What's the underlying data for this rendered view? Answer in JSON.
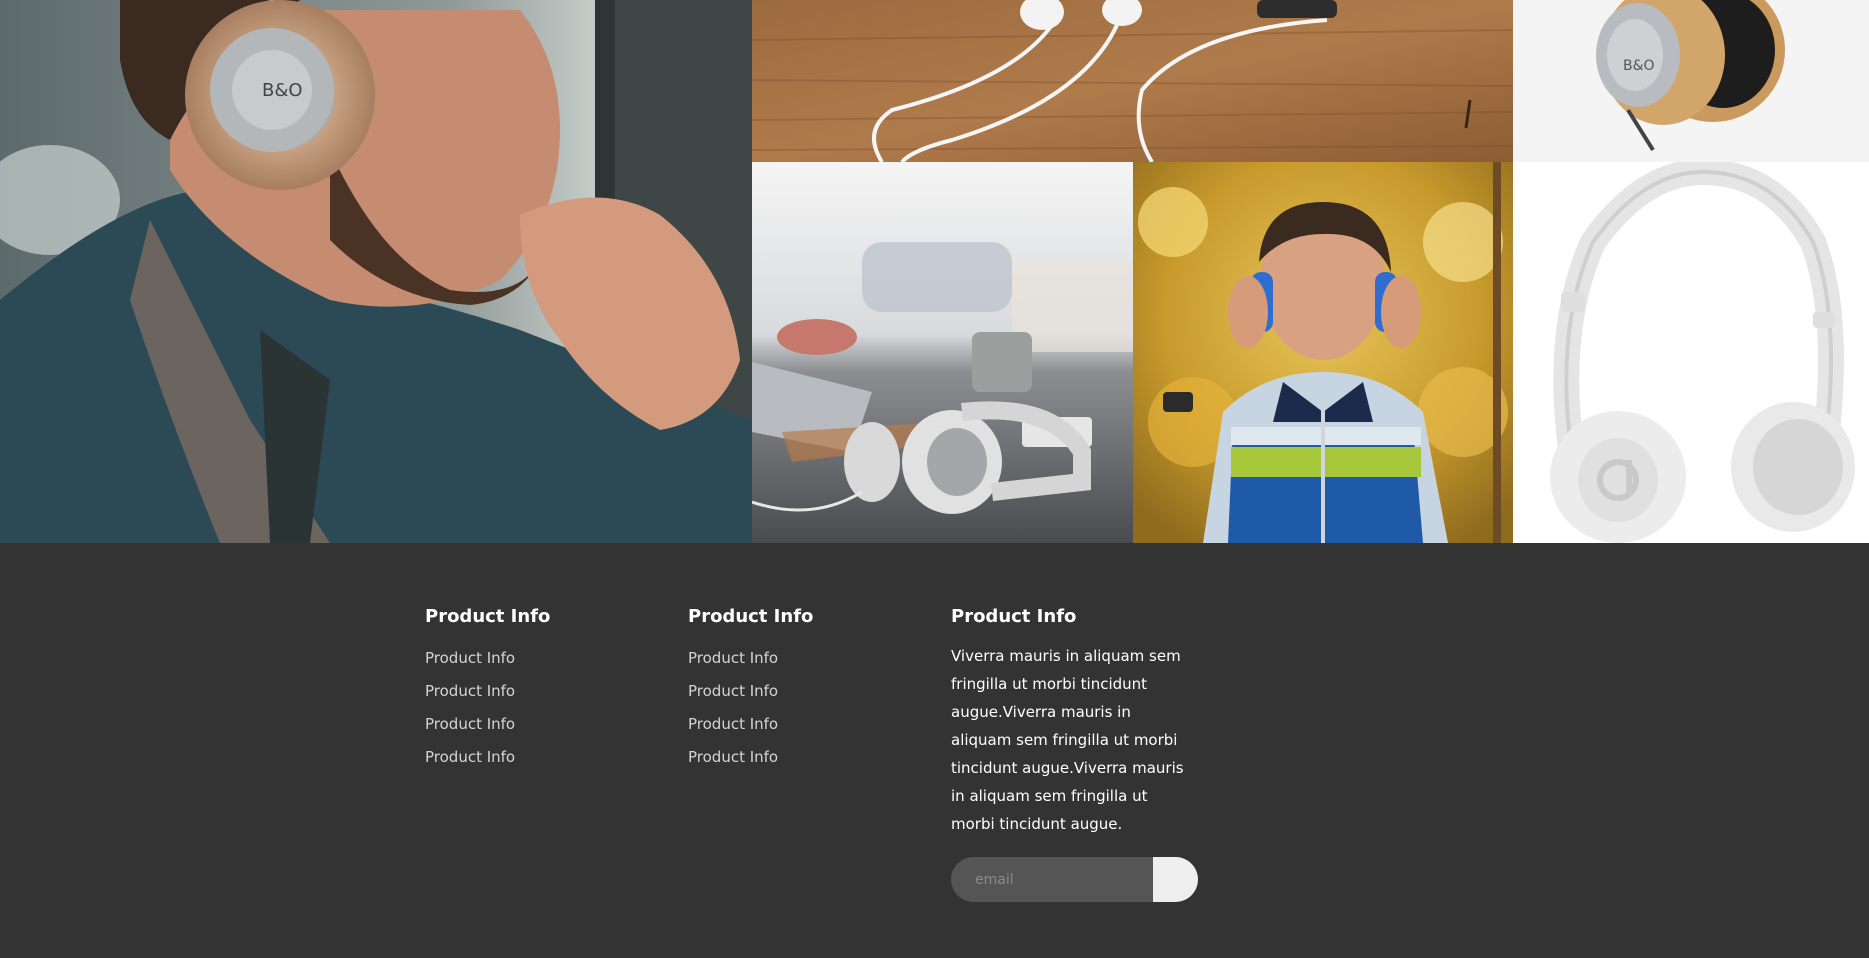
{
  "gallery": {
    "images": [
      {
        "icon": "man-with-headphones-photo"
      },
      {
        "icon": "earbuds-on-wood-photo"
      },
      {
        "icon": "gold-headphones-photo"
      },
      {
        "icon": "headphones-on-desk-photo"
      },
      {
        "icon": "boy-with-headphones-photo"
      },
      {
        "icon": "white-beats-headphones-photo"
      }
    ]
  },
  "footer": {
    "background": "#333333",
    "columns": [
      {
        "heading": "Product Info",
        "links": [
          "Product Info",
          "Product Info",
          "Product Info",
          "Product Info"
        ]
      },
      {
        "heading": "Product Info",
        "links": [
          "Product Info",
          "Product Info",
          "Product Info",
          "Product Info"
        ]
      },
      {
        "heading": "Product Info",
        "text": "Viverra mauris in aliquam sem fringilla ut morbi tincidunt augue.Viverra mauris in aliquam sem fringilla ut morbi tincidunt augue.Viverra mauris in aliquam sem fringilla ut morbi tincidunt augue."
      }
    ],
    "newsletter": {
      "placeholder": "email",
      "button_icon": "submit-icon"
    }
  }
}
